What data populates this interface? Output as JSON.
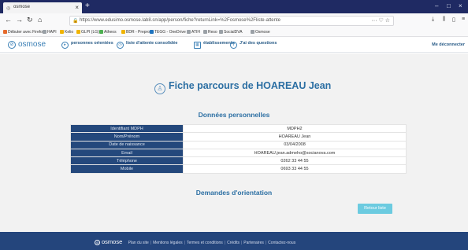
{
  "browser": {
    "tab_title": "osmose",
    "url": "https://www.edusimo.osmose.lab8.sn/app/person/fiche?returnLink=%2Fosmose%2Fliste-attente",
    "bookmarks": [
      {
        "label": "Débuter avec Firefox",
        "color": "#e66a2c"
      },
      {
        "label": "HAPI",
        "color": "#9aa0a6"
      },
      {
        "label": "Kelio",
        "color": "#f0b400"
      },
      {
        "label": "GLPI (LG)",
        "color": "#f0b400"
      },
      {
        "label": "Atheos",
        "color": "#4caf50"
      },
      {
        "label": "BDR - Preprod",
        "color": "#f0b400"
      },
      {
        "label": "TEGG - OneDrive",
        "color": "#1e73be"
      },
      {
        "label": "ATIH",
        "color": "#9aa0a6"
      },
      {
        "label": "Reso",
        "color": "#9aa0a6"
      },
      {
        "label": "SocialDVA",
        "color": "#9aa0a6"
      },
      {
        "label": "Osmose",
        "color": "#9aa0a6"
      }
    ]
  },
  "header": {
    "logo_text": "osmose",
    "nav": [
      {
        "label": "personnes orientées",
        "icon": "arrow-circle-icon"
      },
      {
        "label": "liste d'attente consolidée",
        "icon": "clock-icon"
      },
      {
        "label": "établissements",
        "icon": "building-icon"
      },
      {
        "label": "J'ai des questions",
        "icon": "question-icon"
      }
    ],
    "logout_label": "Me déconnecter"
  },
  "main": {
    "title": "Fiche parcours de HOAREAU Jean",
    "section_personal": "Données personnelles",
    "rows": [
      {
        "key": "Identifiant MDPH",
        "value": "MDPH2"
      },
      {
        "key": "Nom/Prénom",
        "value": "HOAREAU Jean"
      },
      {
        "key": "Date de naissance",
        "value": "03/04/2008"
      },
      {
        "key": "Email",
        "value": "HOAREAU.jean.admeho@socianova.com"
      },
      {
        "key": "Téléphone",
        "value": "0262 33 44 55"
      },
      {
        "key": "Mobile",
        "value": "0693 33 44 55"
      }
    ],
    "section_orientation": "Demandes d'orientation",
    "back_button": "Retour liste"
  },
  "footer": {
    "logo_text": "osmose",
    "links": [
      "Plan du site",
      "Mentions légales",
      "Termes et conditions",
      "Crédits",
      "Partenaires",
      "Contactez-nous"
    ]
  },
  "colors": {
    "header_blue": "#24487c",
    "accent_blue": "#2c6fa3",
    "button_cyan": "#6ccbe0",
    "browser_dark": "#1f2a63"
  }
}
